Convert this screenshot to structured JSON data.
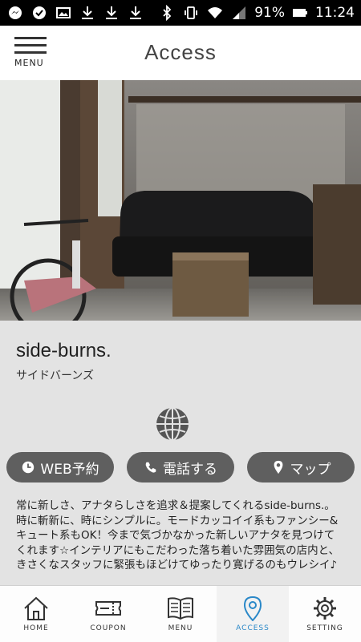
{
  "status_bar": {
    "battery": "91%",
    "time": "11:24",
    "icons": [
      "messenger-icon",
      "check-icon",
      "image-icon",
      "download-icon",
      "download-icon",
      "download-icon",
      "bluetooth-icon",
      "vibrate-icon",
      "wifi-icon",
      "signal-icon",
      "battery-icon"
    ]
  },
  "header": {
    "menu_label": "MENU",
    "title": "Access"
  },
  "shop": {
    "name": "side-burns.",
    "kana": "サイドバーンズ",
    "description": "常に新しさ、アナタらしさを追求＆提案してくれるside-burns.。時に斬新に、時にシンプルに。モードカッコイイ系もファンシー&キュート系もOK！今まで気づかなかった新しいアナタを見つけてくれます☆インテリアにもこだわった落ち着いた雰囲気の店内と、きさくなスタッフに緊張もほどけてゆったり寛げるのもウレシイ♪"
  },
  "actions": {
    "web": "WEB予約",
    "phone": "電話する",
    "map": "マップ"
  },
  "tabs": {
    "home": "HOME",
    "coupon": "COUPON",
    "menu": "MENU",
    "access": "ACCESS",
    "setting": "SETTING"
  },
  "colors": {
    "accent": "#2a88c8",
    "pill": "#5f5f5f",
    "background": "#e3e3e3"
  }
}
